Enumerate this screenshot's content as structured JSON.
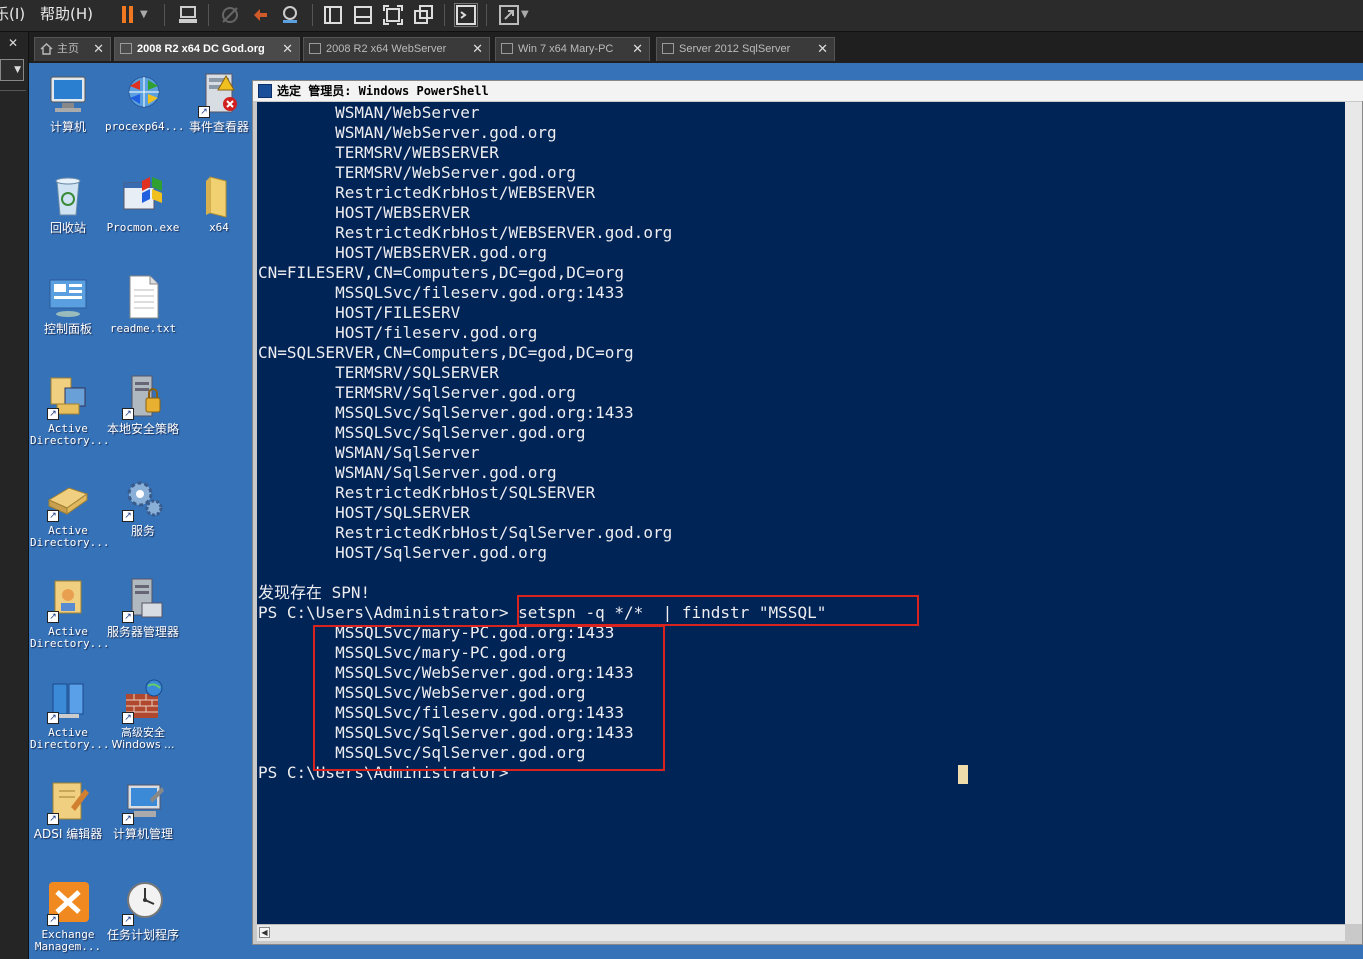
{
  "menu": {
    "item1": "乐(I)",
    "item2": "帮助(H)"
  },
  "tabs": [
    {
      "label": "主页",
      "icon": "home-icon",
      "active": false
    },
    {
      "label": "2008 R2 x64 DC God.org",
      "icon": "vm-icon",
      "active": true
    },
    {
      "label": "2008 R2 x64 WebServer",
      "icon": "vm-icon",
      "active": false
    },
    {
      "label": "Win 7 x64 Mary-PC",
      "icon": "vm-icon",
      "active": false
    },
    {
      "label": "Server 2012 SqlServer",
      "icon": "vm-icon",
      "active": false
    }
  ],
  "tab_close": "✕",
  "desktop_icons": [
    {
      "label": "计算机",
      "icon": "computer-icon"
    },
    {
      "label": "procexp64...",
      "icon": "procexp-icon"
    },
    {
      "label": "事件查看器",
      "icon": "event-viewer-icon"
    },
    {
      "label": "回收站",
      "icon": "recycle-bin-icon"
    },
    {
      "label": "Procmon.exe",
      "icon": "procmon-icon"
    },
    {
      "label": "x64",
      "icon": "folder-icon"
    },
    {
      "label": "控制面板",
      "icon": "control-panel-icon"
    },
    {
      "label": "readme.txt",
      "icon": "text-file-icon"
    },
    {
      "label": "Active\nDirectory...",
      "icon": "ad-sites-icon"
    },
    {
      "label": "本地安全策略",
      "icon": "local-security-policy-icon"
    },
    {
      "label": "Active\nDirectory...",
      "icon": "ad-domains-icon"
    },
    {
      "label": "服务",
      "icon": "services-icon"
    },
    {
      "label": "Active\nDirectory...",
      "icon": "ad-users-icon"
    },
    {
      "label": "服务器管理器",
      "icon": "server-manager-icon"
    },
    {
      "label": "Active\nDirectory...",
      "icon": "ad-module-icon"
    },
    {
      "label": "高级安全\nWindows ...",
      "icon": "firewall-icon"
    },
    {
      "label": "ADSI 编辑器",
      "icon": "adsi-edit-icon"
    },
    {
      "label": "计算机管理",
      "icon": "computer-management-icon"
    },
    {
      "label": "Exchange\nManagem...",
      "icon": "exchange-icon"
    },
    {
      "label": "任务计划程序",
      "icon": "task-scheduler-icon"
    }
  ],
  "powershell": {
    "title": "选定 管理员: Windows PowerShell",
    "lines": [
      "        WSMAN/WebServer",
      "        WSMAN/WebServer.god.org",
      "        TERMSRV/WEBSERVER",
      "        TERMSRV/WebServer.god.org",
      "        RestrictedKrbHost/WEBSERVER",
      "        HOST/WEBSERVER",
      "        RestrictedKrbHost/WEBSERVER.god.org",
      "        HOST/WEBSERVER.god.org",
      "CN=FILESERV,CN=Computers,DC=god,DC=org",
      "        MSSQLSvc/fileserv.god.org:1433",
      "        HOST/FILESERV",
      "        HOST/fileserv.god.org",
      "CN=SQLSERVER,CN=Computers,DC=god,DC=org",
      "        TERMSRV/SQLSERVER",
      "        TERMSRV/SqlServer.god.org",
      "        MSSQLSvc/SqlServer.god.org:1433",
      "        MSSQLSvc/SqlServer.god.org",
      "        WSMAN/SqlServer",
      "        WSMAN/SqlServer.god.org",
      "        RestrictedKrbHost/SQLSERVER",
      "        HOST/SQLSERVER",
      "        RestrictedKrbHost/SqlServer.god.org",
      "        HOST/SqlServer.god.org",
      "",
      "发现存在 SPN!",
      "PS C:\\Users\\Administrator> setspn -q */*  | findstr \"MSSQL\"",
      "        MSSQLSvc/mary-PC.god.org:1433",
      "        MSSQLSvc/mary-PC.god.org",
      "        MSSQLSvc/WebServer.god.org:1433",
      "        MSSQLSvc/WebServer.god.org",
      "        MSSQLSvc/fileserv.god.org:1433",
      "        MSSQLSvc/SqlServer.god.org:1433",
      "        MSSQLSvc/SqlServer.god.org",
      "PS C:\\Users\\Administrator>"
    ]
  },
  "colors": {
    "desktop": "#3572b8",
    "console_bg": "#012456",
    "console_fg": "#eeedf0",
    "highlight": "#d9231f"
  }
}
